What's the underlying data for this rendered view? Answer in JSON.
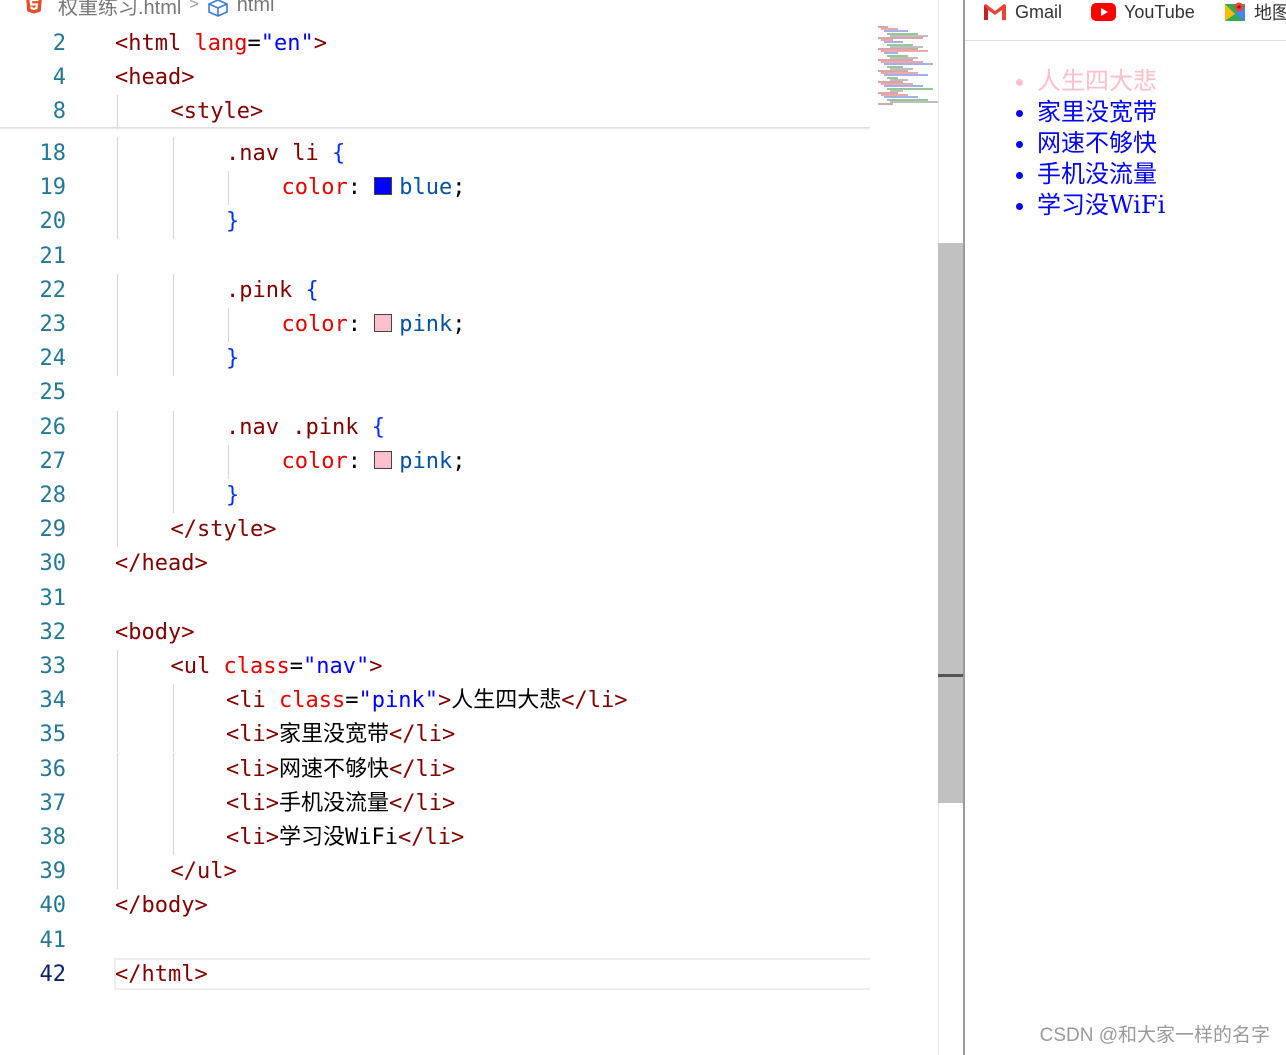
{
  "breadcrumb": {
    "file_name": "权重练习.html",
    "separator": ">",
    "symbol": "html"
  },
  "editor": {
    "sticky_lines": [
      {
        "num": "2",
        "indent": 0,
        "tokens": [
          {
            "t": "<html ",
            "c": "tag"
          },
          {
            "t": "lang",
            "c": "attr"
          },
          {
            "t": "=",
            "c": "plain"
          },
          {
            "t": "\"en\"",
            "c": "str"
          },
          {
            "t": ">",
            "c": "tag"
          }
        ]
      },
      {
        "num": "4",
        "indent": 0,
        "tokens": [
          {
            "t": "<head>",
            "c": "tag"
          }
        ]
      },
      {
        "num": "8",
        "indent": 1,
        "tokens": [
          {
            "t": "<style>",
            "c": "tag"
          }
        ]
      }
    ],
    "lines": [
      {
        "num": "18",
        "indent": 2,
        "tokens": [
          {
            "t": ".nav li ",
            "c": "sel"
          },
          {
            "t": "{",
            "c": "brace"
          }
        ]
      },
      {
        "num": "19",
        "indent": 3,
        "tokens": [
          {
            "t": "color",
            "c": "prop"
          },
          {
            "t": ": ",
            "c": "plain"
          },
          {
            "swatch": "#0000ff"
          },
          {
            "t": "blue",
            "c": "val"
          },
          {
            "t": ";",
            "c": "plain"
          }
        ]
      },
      {
        "num": "20",
        "indent": 2,
        "tokens": [
          {
            "t": "}",
            "c": "brace"
          }
        ]
      },
      {
        "num": "21",
        "indent": 0,
        "tokens": []
      },
      {
        "num": "22",
        "indent": 2,
        "tokens": [
          {
            "t": ".pink ",
            "c": "sel"
          },
          {
            "t": "{",
            "c": "brace"
          }
        ]
      },
      {
        "num": "23",
        "indent": 3,
        "tokens": [
          {
            "t": "color",
            "c": "prop"
          },
          {
            "t": ": ",
            "c": "plain"
          },
          {
            "swatch": "#ffc0cb"
          },
          {
            "t": "pink",
            "c": "val"
          },
          {
            "t": ";",
            "c": "plain"
          }
        ]
      },
      {
        "num": "24",
        "indent": 2,
        "tokens": [
          {
            "t": "}",
            "c": "brace"
          }
        ]
      },
      {
        "num": "25",
        "indent": 0,
        "tokens": []
      },
      {
        "num": "26",
        "indent": 2,
        "tokens": [
          {
            "t": ".nav .pink ",
            "c": "sel"
          },
          {
            "t": "{",
            "c": "brace"
          }
        ]
      },
      {
        "num": "27",
        "indent": 3,
        "tokens": [
          {
            "t": "color",
            "c": "prop"
          },
          {
            "t": ": ",
            "c": "plain"
          },
          {
            "swatch": "#ffc0cb"
          },
          {
            "t": "pink",
            "c": "val"
          },
          {
            "t": ";",
            "c": "plain"
          }
        ]
      },
      {
        "num": "28",
        "indent": 2,
        "tokens": [
          {
            "t": "}",
            "c": "brace"
          }
        ]
      },
      {
        "num": "29",
        "indent": 1,
        "tokens": [
          {
            "t": "</style>",
            "c": "tag"
          }
        ]
      },
      {
        "num": "30",
        "indent": 0,
        "tokens": [
          {
            "t": "</head>",
            "c": "tag"
          }
        ]
      },
      {
        "num": "31",
        "indent": 0,
        "tokens": []
      },
      {
        "num": "32",
        "indent": 0,
        "tokens": [
          {
            "t": "<body>",
            "c": "tag"
          }
        ]
      },
      {
        "num": "33",
        "indent": 1,
        "tokens": [
          {
            "t": "<ul ",
            "c": "tag"
          },
          {
            "t": "class",
            "c": "attr"
          },
          {
            "t": "=",
            "c": "plain"
          },
          {
            "t": "\"nav\"",
            "c": "str"
          },
          {
            "t": ">",
            "c": "tag"
          }
        ]
      },
      {
        "num": "34",
        "indent": 2,
        "tokens": [
          {
            "t": "<li ",
            "c": "tag"
          },
          {
            "t": "class",
            "c": "attr"
          },
          {
            "t": "=",
            "c": "plain"
          },
          {
            "t": "\"pink\"",
            "c": "str"
          },
          {
            "t": ">",
            "c": "tag"
          },
          {
            "t": "人生四大悲",
            "c": "cjk"
          },
          {
            "t": "</li>",
            "c": "tag"
          }
        ]
      },
      {
        "num": "35",
        "indent": 2,
        "tokens": [
          {
            "t": "<li>",
            "c": "tag"
          },
          {
            "t": "家里没宽带",
            "c": "cjk"
          },
          {
            "t": "</li>",
            "c": "tag"
          }
        ]
      },
      {
        "num": "36",
        "indent": 2,
        "tokens": [
          {
            "t": "<li>",
            "c": "tag"
          },
          {
            "t": "网速不够快",
            "c": "cjk"
          },
          {
            "t": "</li>",
            "c": "tag"
          }
        ]
      },
      {
        "num": "37",
        "indent": 2,
        "tokens": [
          {
            "t": "<li>",
            "c": "tag"
          },
          {
            "t": "手机没流量",
            "c": "cjk"
          },
          {
            "t": "</li>",
            "c": "tag"
          }
        ]
      },
      {
        "num": "38",
        "indent": 2,
        "tokens": [
          {
            "t": "<li>",
            "c": "tag"
          },
          {
            "t": "学习没",
            "c": "cjk"
          },
          {
            "t": "WiFi",
            "c": "plain"
          },
          {
            "t": "</li>",
            "c": "tag"
          }
        ]
      },
      {
        "num": "39",
        "indent": 1,
        "tokens": [
          {
            "t": "</ul>",
            "c": "tag"
          }
        ]
      },
      {
        "num": "40",
        "indent": 0,
        "tokens": [
          {
            "t": "</body>",
            "c": "tag"
          }
        ]
      },
      {
        "num": "41",
        "indent": 0,
        "tokens": []
      },
      {
        "num": "42",
        "indent": 0,
        "current": true,
        "tokens": [
          {
            "t": "</html>",
            "c": "tag"
          }
        ]
      }
    ]
  },
  "browser": {
    "bookmarks": [
      {
        "label": "Gmail",
        "icon": "gmail-icon"
      },
      {
        "label": "YouTube",
        "icon": "youtube-icon"
      },
      {
        "label": "地图",
        "icon": "maps-icon"
      }
    ],
    "list_items": [
      {
        "text": "人生四大悲",
        "class": "pink"
      },
      {
        "text": "家里没宽带",
        "class": ""
      },
      {
        "text": "网速不够快",
        "class": ""
      },
      {
        "text": "手机没流量",
        "class": ""
      },
      {
        "text": "学习没WiFi",
        "class": ""
      }
    ]
  },
  "colors": {
    "blue": "#0000ff",
    "pink": "#ffc0cb",
    "tag": "#800000",
    "attr": "#e50000",
    "string": "#0000ff",
    "value": "#0451a5",
    "line_number": "#237893"
  },
  "watermark": "CSDN @和大家一样的名字"
}
